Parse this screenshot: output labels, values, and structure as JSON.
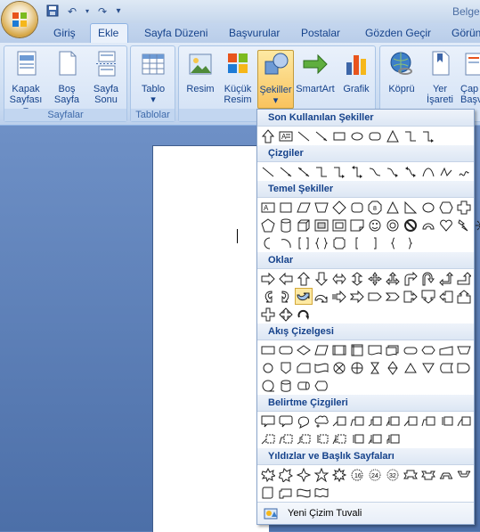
{
  "window": {
    "title": "Belge"
  },
  "qat": {
    "save_icon": "save-icon",
    "undo_icon": "undo-icon",
    "redo_icon": "redo-icon",
    "customize_icon": "customize-icon"
  },
  "tabs": [
    {
      "label": "Giriş"
    },
    {
      "label": "Ekle"
    },
    {
      "label": "Sayfa Düzeni"
    },
    {
      "label": "Başvurular"
    },
    {
      "label": "Postalar"
    },
    {
      "label": "Gözden Geçir"
    },
    {
      "label": "Görün"
    }
  ],
  "ribbon": {
    "groups": [
      {
        "label": "Sayfalar"
      },
      {
        "label": "Tablolar"
      },
      {
        "label": ""
      }
    ],
    "buttons": {
      "kapak1": "Kapak",
      "kapak2": "Sayfası ▾",
      "bos1": "Boş",
      "bos2": "Sayfa",
      "sayfasonu1": "Sayfa",
      "sayfasonu2": "Sonu",
      "tablo1": "Tablo",
      "tablo2": "▾",
      "resim": "Resim",
      "kucuk1": "Küçük",
      "kucuk2": "Resim",
      "sekiller1": "Şekiller",
      "sekiller2": "▾",
      "smartart": "SmartArt",
      "grafik": "Grafik",
      "kopru": "Köprü",
      "yer1": "Yer",
      "yer2": "İşareti",
      "capraz1": "Çap",
      "capraz2": "Başv"
    }
  },
  "shapes_menu": {
    "sections": [
      {
        "title": "Son Kullanılan Şekiller"
      },
      {
        "title": "Çizgiler"
      },
      {
        "title": "Temel Şekiller"
      },
      {
        "title": "Oklar"
      },
      {
        "title": "Akış Çizelgesi"
      },
      {
        "title": "Belirtme Çizgileri"
      },
      {
        "title": "Yıldızlar ve Başlık Sayfaları"
      }
    ],
    "footer_label": "Yeni Çizim Tuvali"
  },
  "colors": {
    "ribbon_bg": "#dfe9f5",
    "highlight": "#fde9a3",
    "accent": "#15428b"
  }
}
